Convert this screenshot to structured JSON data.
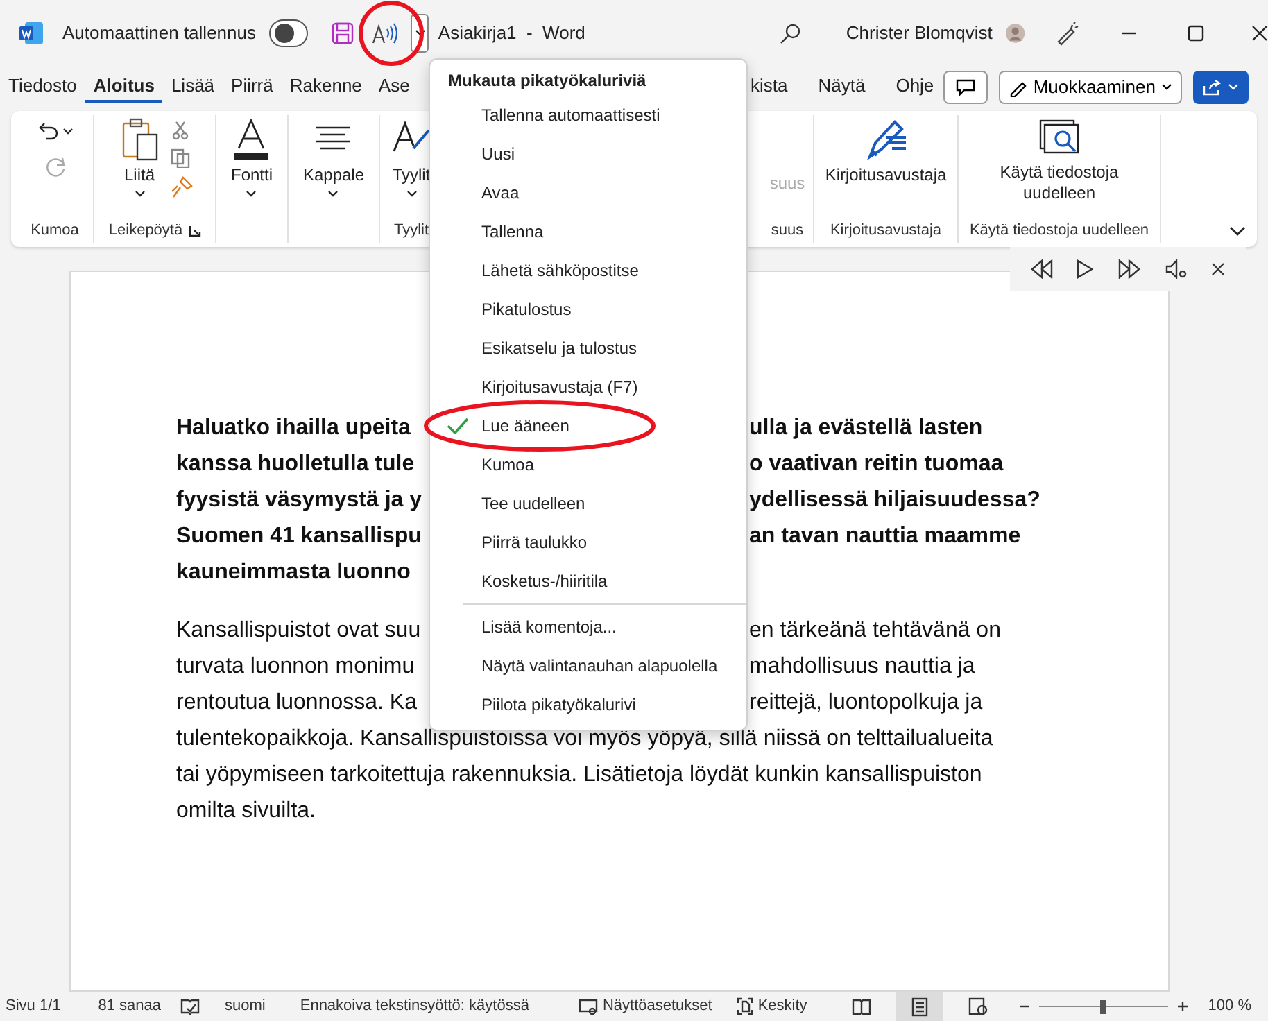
{
  "title_bar": {
    "autosave_label": "Automaattinen tallennus",
    "autosave_on": false,
    "document_title": "Asiakirja1  -  Word",
    "user_name": "Christer Blomqvist"
  },
  "tabs": [
    {
      "label": "Tiedosto",
      "selected": false
    },
    {
      "label": "Aloitus",
      "selected": true
    },
    {
      "label": "Lisää",
      "selected": false
    },
    {
      "label": "Piirrä",
      "selected": false
    },
    {
      "label": "Rakenne",
      "selected": false
    },
    {
      "label": "Ase",
      "selected": false
    }
  ],
  "tabs_right": [
    {
      "label": "kista",
      "selected": false
    },
    {
      "label": "Näytä",
      "selected": false
    },
    {
      "label": "Ohje",
      "selected": false
    }
  ],
  "editing_button": "Muokkaaminen",
  "ribbon": {
    "undo_group": "Kumoa",
    "paste_label": "Liitä",
    "clipboard_group": "Leikepöytä",
    "font_label": "Fontti",
    "paragraph_label": "Kappale",
    "styles_label": "Tyylit",
    "styles_group": "Tyylit",
    "hidden_command": "suus",
    "hidden_group": "suus",
    "editor_label": "Kirjoitusavustaja",
    "editor_group": "Kirjoitusavustaja",
    "reuse_label": "Käytä tiedostoja uudelleen",
    "reuse_group": "Käytä tiedostoja uudelleen"
  },
  "document": {
    "heading_lines": [
      {
        "left": "Haluatko ihailla upeita",
        "right": "ulla ja evästellä lasten"
      },
      {
        "left": "kanssa huolletulla tule",
        "right": "o vaativan reitin tuomaa"
      },
      {
        "left": "fyysistä väsymystä ja y",
        "right": "ydellisessä hiljaisuudessa?"
      },
      {
        "left": "Suomen 41 kansallispu",
        "right": "an tavan nauttia maamme"
      },
      {
        "left": "kauneimmasta luonno"
      }
    ],
    "body_lines": [
      {
        "left": "Kansallispuistot ovat suu",
        "right": "en tärkeänä tehtävänä on"
      },
      {
        "left": "turvata luonnon monimu",
        "right": "mahdollisuus nauttia ja"
      },
      {
        "left": "rentoutua luonnossa. Ka",
        "right": "reittejä, luontopolkuja ja"
      },
      {
        "left": "tulentekopaikkoja. Kansallispuistoissa voi myös yöpyä, sillä niissä on telttailualueita"
      },
      {
        "left": "tai yöpymiseen tarkoitettuja rakennuksia. Lisätietoja löydät kunkin kansallispuiston"
      },
      {
        "left": "omilta sivuilta."
      }
    ]
  },
  "menu": {
    "title": "Mukauta pikatyökaluriviä",
    "toggles": [
      {
        "label": "Tallenna automaattisesti",
        "checked": false
      },
      {
        "label": "Uusi",
        "checked": false
      },
      {
        "label": "Avaa",
        "checked": false
      },
      {
        "label": "Tallenna",
        "checked": false
      },
      {
        "label": "Lähetä sähköpostitse",
        "checked": false
      },
      {
        "label": "Pikatulostus",
        "checked": false
      },
      {
        "label": "Esikatselu ja tulostus",
        "checked": false
      },
      {
        "label": "Kirjoitusavustaja (F7)",
        "checked": false
      },
      {
        "label": "Lue ääneen",
        "checked": true
      },
      {
        "label": "Kumoa",
        "checked": false
      },
      {
        "label": "Tee uudelleen",
        "checked": false
      },
      {
        "label": "Piirrä taulukko",
        "checked": false
      },
      {
        "label": "Kosketus-/hiiritila",
        "checked": false
      }
    ],
    "commands": [
      "Lisää komentoja...",
      "Näytä valintanauhan alapuolella",
      "Piilota pikatyökalurivi"
    ]
  },
  "status_bar": {
    "page": "Sivu 1/1",
    "words": "81 sanaa",
    "language": "suomi",
    "predictive": "Ennakoiva tekstinsyöttö: käytössä",
    "display_settings": "Näyttöasetukset",
    "focus": "Keskity",
    "views": [
      {
        "kind": "read",
        "selected": false
      },
      {
        "kind": "print",
        "selected": true
      },
      {
        "kind": "web",
        "selected": false
      }
    ],
    "zoom": {
      "level": 0.5,
      "reading": "100 %"
    }
  }
}
